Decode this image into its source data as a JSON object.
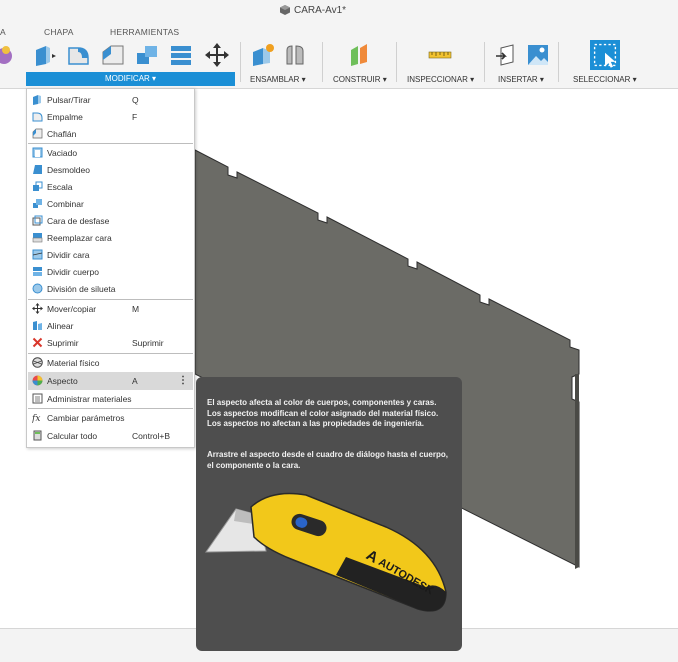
{
  "window": {
    "title": "CARA-Av1*"
  },
  "tabs": [
    "A",
    "CHAPA",
    "HERRAMIENTAS"
  ],
  "toolbar_groups": {
    "modificar": "MODIFICAR ▾",
    "ensamblar": "ENSAMBLAR ▾",
    "construir": "CONSTRUIR ▾",
    "inspeccionar": "INSPECCIONAR ▾",
    "insertar": "INSERTAR ▾",
    "seleccionar": "SELECCIONAR ▾"
  },
  "menu": {
    "items": [
      {
        "label": "Pulsar/Tirar",
        "shortcut": "Q",
        "icon": "press-pull-icon"
      },
      {
        "label": "Empalme",
        "shortcut": "F",
        "icon": "fillet-icon"
      },
      {
        "label": "Chaflán",
        "shortcut": "",
        "icon": "chamfer-icon"
      },
      {
        "label": "Vaciado",
        "shortcut": "",
        "icon": "shell-icon"
      },
      {
        "label": "Desmoldeo",
        "shortcut": "",
        "icon": "draft-icon"
      },
      {
        "label": "Escala",
        "shortcut": "",
        "icon": "scale-icon"
      },
      {
        "label": "Combinar",
        "shortcut": "",
        "icon": "combine-icon"
      },
      {
        "label": "Cara de desfase",
        "shortcut": "",
        "icon": "offset-face-icon"
      },
      {
        "label": "Reemplazar cara",
        "shortcut": "",
        "icon": "replace-face-icon"
      },
      {
        "label": "Dividir cara",
        "shortcut": "",
        "icon": "split-face-icon"
      },
      {
        "label": "Dividir cuerpo",
        "shortcut": "",
        "icon": "split-body-icon"
      },
      {
        "label": "División de silueta",
        "shortcut": "",
        "icon": "silhouette-split-icon"
      },
      {
        "label": "Mover/copiar",
        "shortcut": "M",
        "icon": "move-icon"
      },
      {
        "label": "Alinear",
        "shortcut": "",
        "icon": "align-icon"
      },
      {
        "label": "Suprimir",
        "shortcut": "Suprimir",
        "icon": "delete-icon"
      },
      {
        "label": "Material físico",
        "shortcut": "",
        "icon": "physical-material-icon"
      },
      {
        "label": "Aspecto",
        "shortcut": "A",
        "icon": "appearance-icon"
      },
      {
        "label": "Administrar materiales",
        "shortcut": "",
        "icon": "manage-materials-icon"
      },
      {
        "label": "Cambiar parámetros",
        "shortcut": "",
        "icon": "parameters-icon"
      },
      {
        "label": "Calcular todo",
        "shortcut": "Control+B",
        "icon": "compute-all-icon"
      }
    ],
    "more_glyph": "⋮"
  },
  "tooltip": {
    "para1": "El aspecto afecta al color de cuerpos, componentes y caras. Los aspectos modifican el color asignado del material físico. Los aspectos no afectan a las propiedades de ingeniería.",
    "para2": "Arrastre el aspecto desde el cuadro de diálogo hasta el cuerpo, el componente o la cara.",
    "image_text": "AUTODESK"
  },
  "colors": {
    "accent": "#1b8fd6",
    "panel": "#6b6b66",
    "tooltip_bg": "#4e4e4e"
  }
}
